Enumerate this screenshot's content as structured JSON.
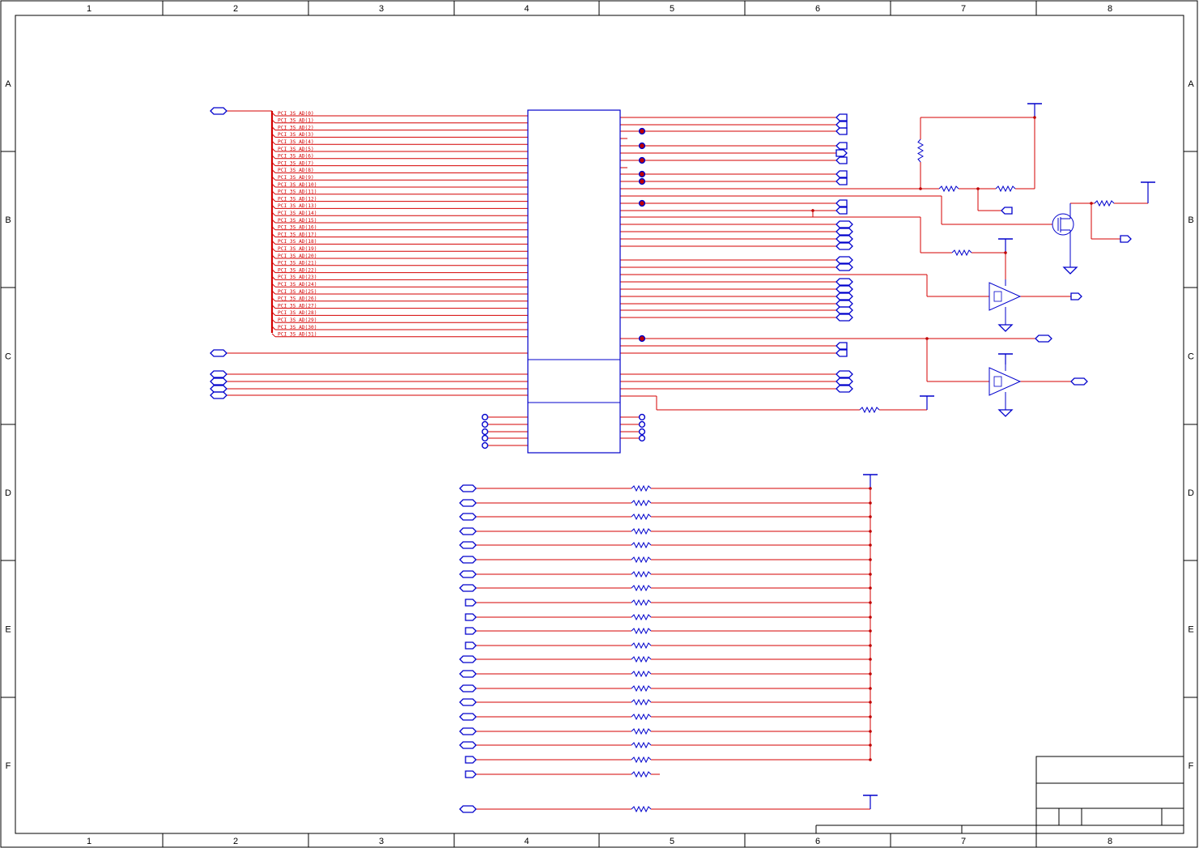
{
  "sheet": {
    "column_labels": [
      "1",
      "2",
      "3",
      "4",
      "5",
      "6",
      "7",
      "8"
    ],
    "row_labels": [
      "A",
      "B",
      "C",
      "D",
      "E",
      "F"
    ]
  },
  "bus": {
    "net_labels": [
      "PCI_3S_AD(0)",
      "PCI_3S_AD(1)",
      "PCI_3S_AD(2)",
      "PCI_3S_AD(3)",
      "PCI_3S_AD(4)",
      "PCI_3S_AD(5)",
      "PCI_3S_AD(6)",
      "PCI_3S_AD(7)",
      "PCI_3S_AD(8)",
      "PCI_3S_AD(9)",
      "PCI_3S_AD(10)",
      "PCI_3S_AD(11)",
      "PCI_3S_AD(12)",
      "PCI_3S_AD(13)",
      "PCI_3S_AD(14)",
      "PCI_3S_AD(15)",
      "PCI_3S_AD(16)",
      "PCI_3S_AD(17)",
      "PCI_3S_AD(18)",
      "PCI_3S_AD(19)",
      "PCI_3S_AD(20)",
      "PCI_3S_AD(21)",
      "PCI_3S_AD(22)",
      "PCI_3S_AD(23)",
      "PCI_3S_AD(24)",
      "PCI_3S_AD(25)",
      "PCI_3S_AD(26)",
      "PCI_3S_AD(27)",
      "PCI_3S_AD(28)",
      "PCI_3S_AD(29)",
      "PCI_3S_AD(30)",
      "PCI_3S_AD(31)"
    ]
  },
  "colors": {
    "frame": "#000000",
    "wire": "#d40000",
    "component": "#0000cc",
    "junction": "#c00000"
  },
  "icons": {
    "port": "hexagon-port-icon",
    "resistor": "resistor-icon",
    "ground": "ground-icon",
    "power": "power-rail-icon",
    "opamp": "opamp-icon",
    "mosfet": "mosfet-icon"
  }
}
